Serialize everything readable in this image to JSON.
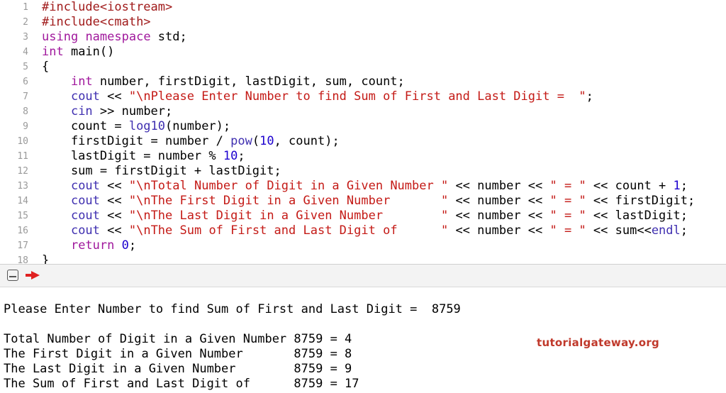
{
  "editor": {
    "lines": [
      {
        "n": "1",
        "tokens": [
          {
            "t": "#include",
            "c": "pp"
          },
          {
            "t": "<iostream>",
            "c": "pp"
          }
        ]
      },
      {
        "n": "2",
        "tokens": [
          {
            "t": "#include",
            "c": "pp"
          },
          {
            "t": "<cmath>",
            "c": "pp"
          }
        ]
      },
      {
        "n": "3",
        "tokens": [
          {
            "t": "using",
            "c": "kw"
          },
          {
            "t": " ",
            "c": "plain"
          },
          {
            "t": "namespace",
            "c": "kw"
          },
          {
            "t": " std;",
            "c": "plain"
          }
        ]
      },
      {
        "n": "4",
        "tokens": [
          {
            "t": "int",
            "c": "type"
          },
          {
            "t": " main()",
            "c": "plain"
          }
        ]
      },
      {
        "n": "5",
        "tokens": [
          {
            "t": "{",
            "c": "plain"
          }
        ]
      },
      {
        "n": "6",
        "tokens": [
          {
            "t": "    ",
            "c": "plain"
          },
          {
            "t": "int",
            "c": "type"
          },
          {
            "t": " number, firstDigit, lastDigit, sum, count;",
            "c": "plain"
          }
        ]
      },
      {
        "n": "7",
        "tokens": [
          {
            "t": "    ",
            "c": "plain"
          },
          {
            "t": "cout",
            "c": "fn"
          },
          {
            "t": " << ",
            "c": "plain"
          },
          {
            "t": "\"\\nPlease Enter Number to find Sum of First and Last Digit =  \"",
            "c": "str"
          },
          {
            "t": ";",
            "c": "plain"
          }
        ]
      },
      {
        "n": "8",
        "tokens": [
          {
            "t": "    ",
            "c": "plain"
          },
          {
            "t": "cin",
            "c": "fn"
          },
          {
            "t": " >> number;",
            "c": "plain"
          }
        ]
      },
      {
        "n": "9",
        "tokens": [
          {
            "t": "    count = ",
            "c": "plain"
          },
          {
            "t": "log10",
            "c": "fn"
          },
          {
            "t": "(number);",
            "c": "plain"
          }
        ]
      },
      {
        "n": "10",
        "tokens": [
          {
            "t": "    firstDigit = number / ",
            "c": "plain"
          },
          {
            "t": "pow",
            "c": "fn"
          },
          {
            "t": "(",
            "c": "plain"
          },
          {
            "t": "10",
            "c": "num"
          },
          {
            "t": ", count);",
            "c": "plain"
          }
        ]
      },
      {
        "n": "11",
        "tokens": [
          {
            "t": "    lastDigit = number % ",
            "c": "plain"
          },
          {
            "t": "10",
            "c": "num"
          },
          {
            "t": ";",
            "c": "plain"
          }
        ]
      },
      {
        "n": "12",
        "tokens": [
          {
            "t": "    sum = firstDigit + lastDigit;",
            "c": "plain"
          }
        ]
      },
      {
        "n": "13",
        "tokens": [
          {
            "t": "    ",
            "c": "plain"
          },
          {
            "t": "cout",
            "c": "fn"
          },
          {
            "t": " << ",
            "c": "plain"
          },
          {
            "t": "\"\\nTotal Number of Digit in a Given Number \"",
            "c": "str"
          },
          {
            "t": " << number << ",
            "c": "plain"
          },
          {
            "t": "\" = \"",
            "c": "str"
          },
          {
            "t": " << count + ",
            "c": "plain"
          },
          {
            "t": "1",
            "c": "num"
          },
          {
            "t": ";",
            "c": "plain"
          }
        ]
      },
      {
        "n": "14",
        "tokens": [
          {
            "t": "    ",
            "c": "plain"
          },
          {
            "t": "cout",
            "c": "fn"
          },
          {
            "t": " << ",
            "c": "plain"
          },
          {
            "t": "\"\\nThe First Digit in a Given Number       \"",
            "c": "str"
          },
          {
            "t": " << number << ",
            "c": "plain"
          },
          {
            "t": "\" = \"",
            "c": "str"
          },
          {
            "t": " << firstDigit;",
            "c": "plain"
          }
        ]
      },
      {
        "n": "15",
        "tokens": [
          {
            "t": "    ",
            "c": "plain"
          },
          {
            "t": "cout",
            "c": "fn"
          },
          {
            "t": " << ",
            "c": "plain"
          },
          {
            "t": "\"\\nThe Last Digit in a Given Number        \"",
            "c": "str"
          },
          {
            "t": " << number << ",
            "c": "plain"
          },
          {
            "t": "\" = \"",
            "c": "str"
          },
          {
            "t": " << lastDigit;",
            "c": "plain"
          }
        ]
      },
      {
        "n": "16",
        "tokens": [
          {
            "t": "    ",
            "c": "plain"
          },
          {
            "t": "cout",
            "c": "fn"
          },
          {
            "t": " << ",
            "c": "plain"
          },
          {
            "t": "\"\\nThe Sum of First and Last Digit of      \"",
            "c": "str"
          },
          {
            "t": " << number << ",
            "c": "plain"
          },
          {
            "t": "\" = \"",
            "c": "str"
          },
          {
            "t": " << sum<<",
            "c": "plain"
          },
          {
            "t": "endl",
            "c": "fn"
          },
          {
            "t": ";",
            "c": "plain"
          }
        ]
      },
      {
        "n": "17",
        "tokens": [
          {
            "t": "    ",
            "c": "plain"
          },
          {
            "t": "return",
            "c": "kw"
          },
          {
            "t": " ",
            "c": "plain"
          },
          {
            "t": "0",
            "c": "num"
          },
          {
            "t": ";",
            "c": "plain"
          }
        ]
      },
      {
        "n": "18",
        "tokens": [
          {
            "t": "}",
            "c": "plain"
          }
        ]
      }
    ]
  },
  "toolbar": {
    "console_toggle_icon": "console-toggle-icon",
    "run_icon": "breakpoint-arrow-icon"
  },
  "console": {
    "prompt_line": "Please Enter Number to find Sum of First and Last Digit =  8759",
    "output_lines": [
      "Total Number of Digit in a Given Number 8759 = 4",
      "The First Digit in a Given Number       8759 = 8",
      "The Last Digit in a Given Number        8759 = 9",
      "The Sum of First and Last Digit of      8759 = 17"
    ]
  },
  "watermark": "tutorialgateway.org",
  "colors": {
    "keyword": "#a0189c",
    "preprocessor": "#a01a1a",
    "string": "#c41a16",
    "number": "#1c00cf",
    "function": "#3f2fb0",
    "run_arrow": "#e02121"
  }
}
